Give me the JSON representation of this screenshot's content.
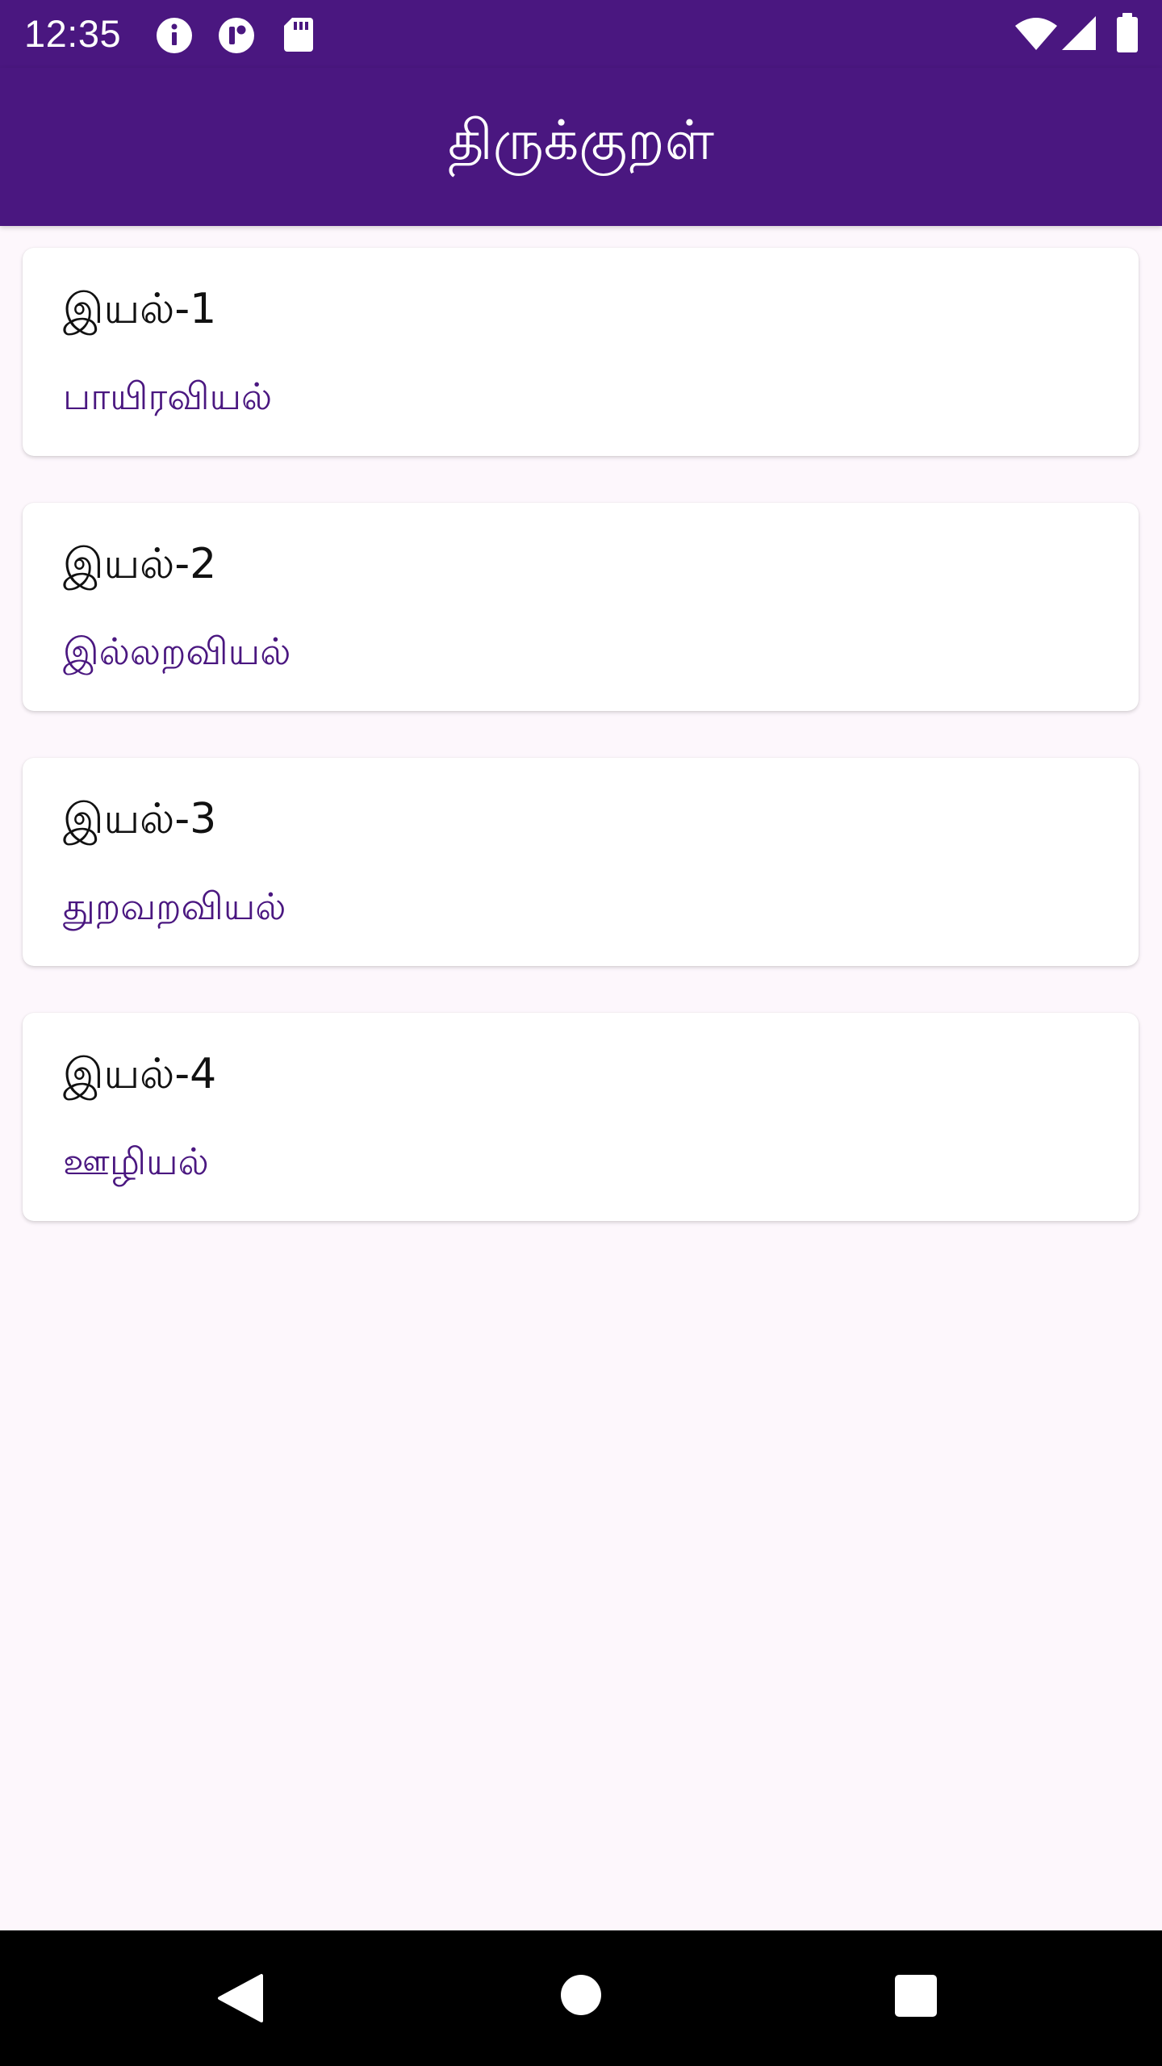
{
  "status_bar": {
    "time": "12:35",
    "left_icons": [
      "info-icon",
      "vpn-key-icon",
      "sd-card-icon"
    ],
    "right_icons": [
      "wifi-icon",
      "cell-signal-icon",
      "battery-icon"
    ]
  },
  "app_bar": {
    "title": "திருக்குறள்"
  },
  "sections": [
    {
      "title": "இயல்-1",
      "subtitle": "பாயிரவியல்"
    },
    {
      "title": "இயல்-2",
      "subtitle": "இல்லறவியல்"
    },
    {
      "title": "இயல்-3",
      "subtitle": "துறவறவியல்"
    },
    {
      "title": "இயல்-4",
      "subtitle": "ஊழியல்"
    }
  ],
  "nav_bar": {
    "buttons": [
      "back-icon",
      "home-icon",
      "recents-icon"
    ]
  },
  "colors": {
    "primary": "#4A1780",
    "background": "#FDF7FC",
    "card": "#FFFFFF",
    "title_text": "#111111",
    "subtitle_text": "#4A1780",
    "nav_bar": "#000000"
  }
}
